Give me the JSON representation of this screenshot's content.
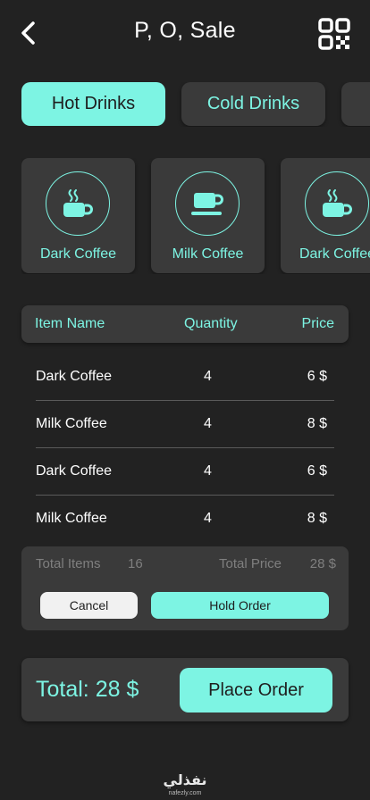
{
  "header": {
    "title": "P, O, Sale",
    "back_icon": "chevron-left-icon",
    "qr_icon": "qr-code-icon"
  },
  "tabs": [
    {
      "label": "Hot Drinks",
      "active": true
    },
    {
      "label": "Cold Drinks",
      "active": false
    },
    {
      "label": "",
      "active": false
    }
  ],
  "products": [
    {
      "name": "Dark Coffee",
      "icon": "hot-coffee-mug-icon"
    },
    {
      "name": "Milk Coffee",
      "icon": "coffee-cup-saucer-icon"
    },
    {
      "name": "Dark Coffee",
      "icon": "hot-coffee-mug-icon"
    }
  ],
  "order": {
    "headers": {
      "name": "Item Name",
      "quantity": "Quantity",
      "price": "Price"
    },
    "rows": [
      {
        "name": "Dark Coffee",
        "quantity": "4",
        "price": "6 $"
      },
      {
        "name": "Milk Coffee",
        "quantity": "4",
        "price": "8 $"
      },
      {
        "name": "Dark Coffee",
        "quantity": "4",
        "price": "6 $"
      },
      {
        "name": "Milk Coffee",
        "quantity": "4",
        "price": "8 $"
      }
    ],
    "summary": {
      "total_items_label": "Total Items",
      "total_items_value": "16",
      "total_price_label": "Total Price",
      "total_price_value": "28 $"
    },
    "cancel_label": "Cancel",
    "hold_label": "Hold Order"
  },
  "footer": {
    "total_label": "Total: 28 $",
    "place_order_label": "Place Order"
  },
  "watermark": {
    "logo": "نفذلي",
    "url": "nafezly.com"
  },
  "colors": {
    "background": "#222222",
    "card": "#3a3a3a",
    "accent": "#7df4e3",
    "muted": "#7f7f7f"
  }
}
